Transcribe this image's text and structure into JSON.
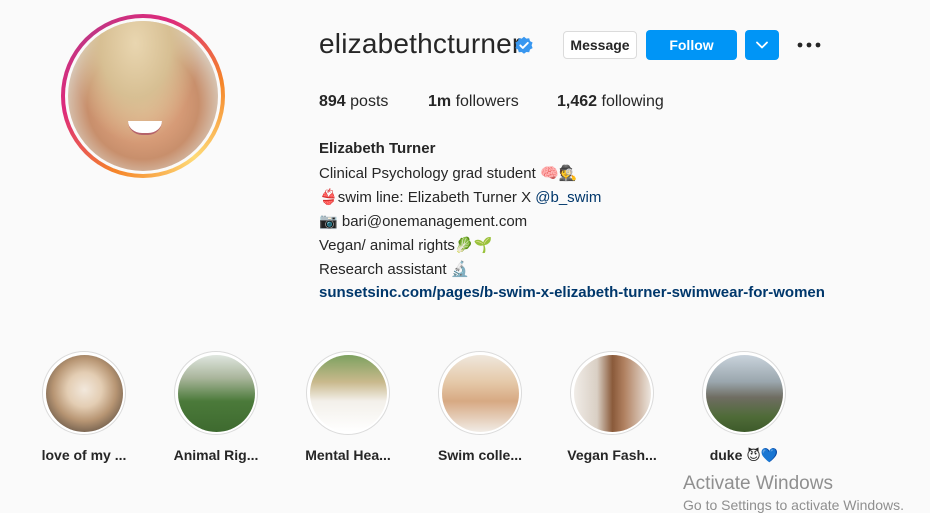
{
  "profile": {
    "username": "elizabethcturner",
    "verified_icon": "verified-badge-icon",
    "message_label": "Message",
    "follow_label": "Follow",
    "dropdown_icon": "chevron-down-icon",
    "more_icon": "more-options-icon"
  },
  "stats": {
    "posts_count": "894",
    "posts_label": "posts",
    "followers_count": "1m",
    "followers_label": "followers",
    "following_count": "1,462",
    "following_label": "following"
  },
  "bio": {
    "full_name": "Elizabeth Turner",
    "line1_text": "Clinical Psychology grad student ",
    "line1_emoji": "🧠🕵",
    "line2_emoji": "👙",
    "line2_text": "swim line: Elizabeth Turner X ",
    "line2_mention": "@b_swim",
    "line3_emoji": "📷",
    "line3_text": " bari@onemanagement.com",
    "line4_text": "Vegan/ animal rights",
    "line4_emoji": "🥬🌱",
    "line5_text": "Research assistant ",
    "line5_emoji": "🔬",
    "website": "sunsetsinc.com/pages/b-swim-x-elizabeth-turner-swimwear-for-women"
  },
  "highlights": [
    {
      "label": "love of my ..."
    },
    {
      "label": "Animal Rig..."
    },
    {
      "label": "Mental Hea..."
    },
    {
      "label": "Swim colle..."
    },
    {
      "label": "Vegan Fash..."
    },
    {
      "label": "duke",
      "emoji": "😈💙"
    }
  ],
  "watermark": {
    "title": "Activate Windows",
    "subtitle": "Go to Settings to activate Windows."
  },
  "colors": {
    "primary_blue": "#0095f6",
    "link_blue": "#00376b",
    "verified_blue": "#3897f0"
  }
}
